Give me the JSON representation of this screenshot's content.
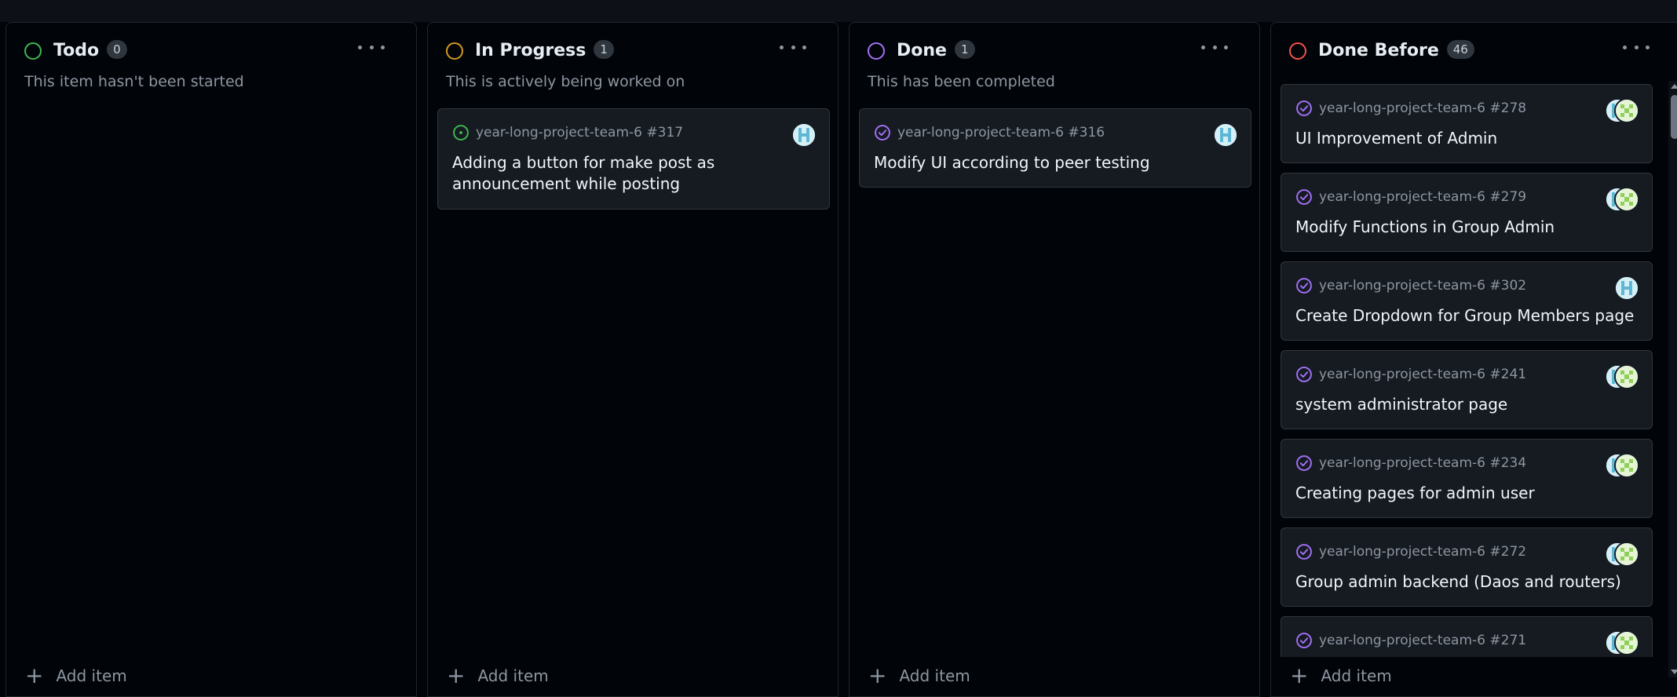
{
  "colors": {
    "todo": "#3fb950",
    "in_progress": "#d29922",
    "done": "#a371f7",
    "done_before": "#f85149",
    "issue_open": "#3fb950",
    "issue_closed": "#a371f7"
  },
  "columns": [
    {
      "title": "Todo",
      "count": "0",
      "description": "This item hasn't been started",
      "add_item_label": "Add item",
      "cards": []
    },
    {
      "title": "In Progress",
      "count": "1",
      "description": "This is actively being worked on",
      "add_item_label": "Add item",
      "cards": [
        {
          "repo": "year-long-project-team-6 #317",
          "title": "Adding a button for make post as announcement while posting",
          "state_icon": "issue-open-icon"
        }
      ]
    },
    {
      "title": "Done",
      "count": "1",
      "description": "This has been completed",
      "add_item_label": "Add item",
      "cards": [
        {
          "repo": "year-long-project-team-6 #316",
          "title": "Modify UI according to peer testing",
          "state_icon": "issue-closed-icon"
        }
      ]
    },
    {
      "title": "Done Before",
      "count": "46",
      "description": "",
      "add_item_label": "Add item",
      "cards": [
        {
          "repo": "year-long-project-team-6 #278",
          "title": "UI Improvement of Admin",
          "state_icon": "issue-closed-icon"
        },
        {
          "repo": "year-long-project-team-6 #279",
          "title": "Modify Functions in Group Admin",
          "state_icon": "issue-closed-icon"
        },
        {
          "repo": "year-long-project-team-6 #302",
          "title": "Create Dropdown for Group Members page",
          "state_icon": "issue-closed-icon"
        },
        {
          "repo": "year-long-project-team-6 #241",
          "title": "system administrator page",
          "state_icon": "issue-closed-icon"
        },
        {
          "repo": "year-long-project-team-6 #234",
          "title": "Creating pages for admin user",
          "state_icon": "issue-closed-icon"
        },
        {
          "repo": "year-long-project-team-6 #272",
          "title": "Group admin backend (Daos and routers)",
          "state_icon": "issue-closed-icon"
        },
        {
          "repo": "year-long-project-team-6 #271",
          "title": "",
          "state_icon": "issue-closed-icon"
        }
      ]
    }
  ]
}
